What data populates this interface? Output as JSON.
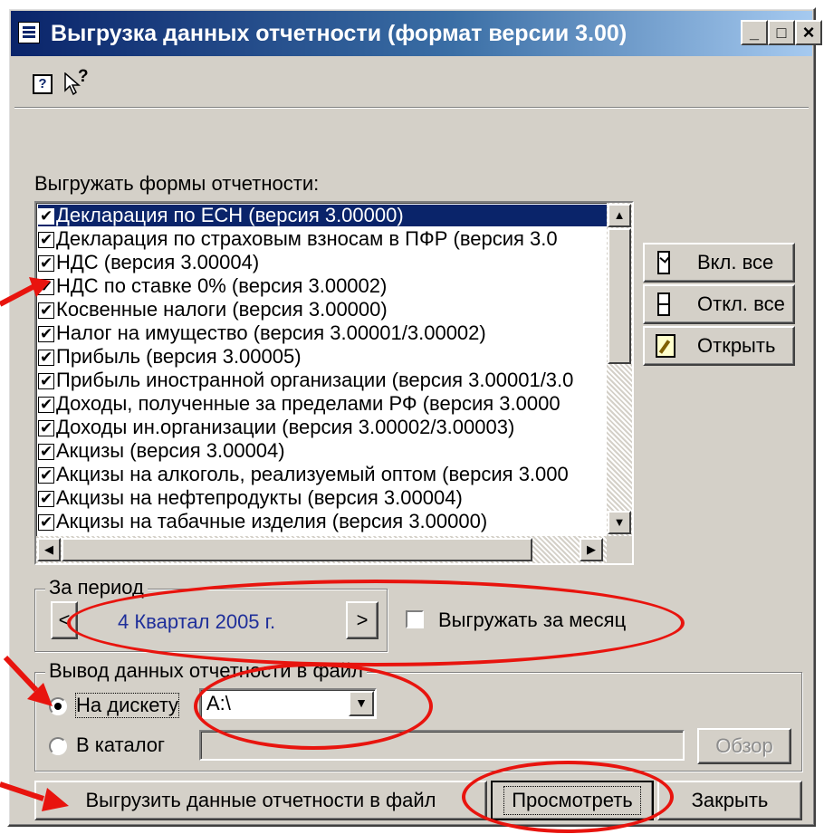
{
  "window": {
    "title": "Выгрузка данных отчетности (формат версии 3.00)",
    "minimize_label": "_",
    "maximize_label": "□",
    "close_label": "×"
  },
  "toolbar": {
    "help_label": "?",
    "whatsthis_label": "?"
  },
  "forms": {
    "label": "Выгружать формы отчетности:",
    "items": [
      "Декларация по ЕСН (версия 3.00000)",
      "Декларация по страховым взносам в ПФР (версия 3.0",
      "НДС (версия 3.00004)",
      "НДС по ставке 0% (версия 3.00002)",
      "Косвенные налоги (версия 3.00000)",
      "Налог на имущество (версия 3.00001/3.00002)",
      "Прибыль (версия 3.00005)",
      "Прибыль иностранной организации (версия 3.00001/3.0",
      "Доходы, полученные за пределами РФ (версия 3.0000",
      "Доходы ин.организации (версия 3.00002/3.00003)",
      "Акцизы (версия 3.00004)",
      "Акцизы на алкоголь, реализуемый оптом (версия 3.000",
      "Акцизы на нефтепродукты (версия 3.00004)",
      "Акцизы на табачные изделия (версия 3.00000)"
    ],
    "enable_all_label": "Вкл. все",
    "disable_all_label": "Откл. все",
    "open_label": "Открыть"
  },
  "period": {
    "group_label": "За период",
    "prev_label": "<",
    "value": "4 Квартал 2005 г.",
    "next_label": ">",
    "month_checkbox_label": "Выгружать за месяц"
  },
  "output": {
    "group_label": "Вывод данных отчетности в файл",
    "floppy_label": "На дискету",
    "floppy_drive": "A:\\",
    "catalog_label": "В каталог",
    "catalog_path": "",
    "browse_label": "Обзор"
  },
  "actions": {
    "export_label": "Выгрузить данные отчетности в файл",
    "preview_label": "Просмотреть",
    "close_label": "Закрыть"
  },
  "colors": {
    "annotation": "#e8140e",
    "title_bar": "#0a246a",
    "period_text": "#1f2f9a"
  }
}
